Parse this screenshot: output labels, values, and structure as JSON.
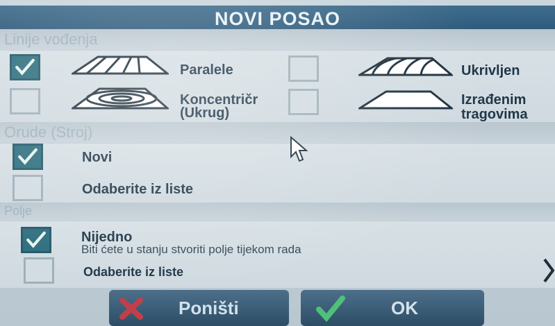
{
  "header": {
    "title": "NOVI POSAO"
  },
  "sections": {
    "guidance": "Linije vođenja",
    "implement": "Orude (Stroj)",
    "field": "Polje"
  },
  "guidance": {
    "parallel": {
      "label": "Paralele",
      "checked": true
    },
    "curved": {
      "label": "Ukrivljen",
      "checked": false
    },
    "concentric": {
      "label_line1": "Koncentričr",
      "label_line2": "(Ukrug)",
      "checked": false
    },
    "tracks": {
      "label_line1": "Izrađenim",
      "label_line2": "tragovima",
      "checked": false
    }
  },
  "implement": {
    "new": {
      "label": "Novi",
      "checked": true
    },
    "from_list": {
      "label": "Odaberite iz liste",
      "checked": false
    }
  },
  "field": {
    "none": {
      "label": "Nijedno",
      "hint": "Biti ćete u stanju stvoriti polje tijekom rada",
      "checked": true
    },
    "from_list": {
      "label": "Odaberite iz liste",
      "checked": false
    }
  },
  "buttons": {
    "cancel": "Poništi",
    "ok": "OK"
  },
  "colors": {
    "title_bar": "#2f5b7b",
    "check_on": "#2d6d7e",
    "tick": "#e6f6ee",
    "cancel_x": "#c0404a"
  }
}
